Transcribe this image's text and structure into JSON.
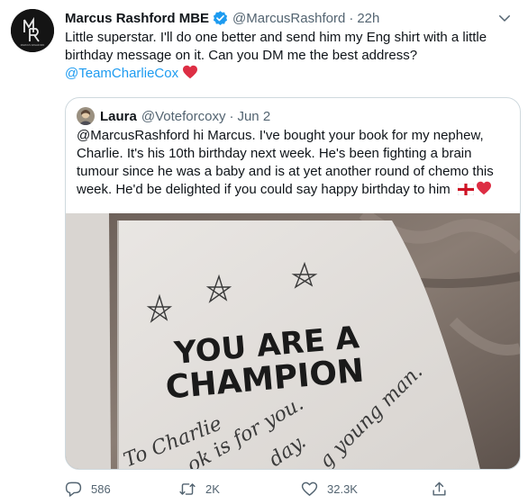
{
  "tweet": {
    "author_name": "Marcus Rashford MBE",
    "handle": "@MarcusRashford",
    "separator": "·",
    "time": "22h",
    "text_lines": [
      "Little superstar. I'll do one better and send him my Eng shirt with a little",
      "birthday message on it. Can you DM me the best address?"
    ],
    "mention": "@TeamCharlieCox",
    "avatar_caption": "MARCUS RASHFORD"
  },
  "quote": {
    "author_name": "Laura",
    "handle": "@Voteforcoxy",
    "separator": "·",
    "date": "Jun 2",
    "text_lines": [
      "@MarcusRashford hi Marcus. I've bought your book for my nephew,",
      "Charlie. It's his 10th birthday next week. He's been fighting a brain",
      "tumour since he was a baby and is at yet another round of chemo this",
      "week. He'd be delighted if you could say happy birthday to him"
    ],
    "image": {
      "book_line1": "YOU ARE A",
      "book_line2": "CHAMPION",
      "handwriting": [
        "To Charlie",
        "ok is for you.",
        "day.",
        "g young man."
      ]
    }
  },
  "actions": {
    "reply_count": "586",
    "retweet_count": "2K",
    "like_count": "32.3K"
  },
  "colors": {
    "accent": "#1d9bf0",
    "secondary_text": "#536471",
    "heart": "#e0245e",
    "border": "#cfd9de"
  },
  "icons": [
    "verified-badge-icon",
    "more-options-icon",
    "red-heart-icon",
    "england-flag-icon",
    "reply-icon",
    "retweet-icon",
    "like-icon",
    "share-icon"
  ]
}
